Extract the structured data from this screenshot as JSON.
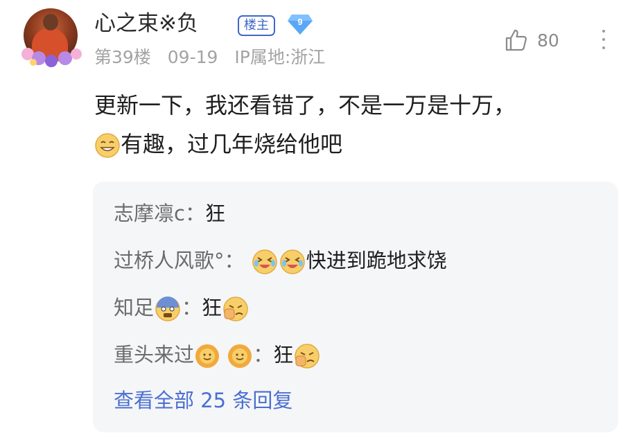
{
  "post": {
    "username": "心之束※负",
    "floor_badge": "楼主",
    "level_badge": "9",
    "floor": "第39楼",
    "date": "09-19",
    "ip_location": "IP属地:浙江",
    "like_count": "80",
    "content_line1": "更新一下，我还看错了，不是一万是十万，",
    "content_line2": "有趣，过几年烧给他吧"
  },
  "replies": {
    "items": [
      {
        "author": "志摩凛c",
        "separator": "：",
        "text": "狂"
      },
      {
        "author": "过桥人风歌°",
        "separator": "：",
        "text": "快进到跪地求饶"
      },
      {
        "author": "知足",
        "separator": "：",
        "text": "狂"
      },
      {
        "author": "重头来过",
        "separator": "：",
        "text": "狂"
      }
    ],
    "view_all": "查看全部 25 条回复"
  },
  "colors": {
    "link_blue": "#4a6fd1",
    "badge_blue": "#3e66c9",
    "meta_gray": "#a3a3a3",
    "reply_bg": "#f5f6f8"
  },
  "icons": [
    "avatar",
    "level-gem-icon",
    "thumbs-up-icon",
    "more-vertical-icon",
    "grin-emoji-icon",
    "laughing-tears-emoji-icon",
    "scared-emoji-icon",
    "fist-emoji-icon",
    "sun-emoji-icon"
  ]
}
